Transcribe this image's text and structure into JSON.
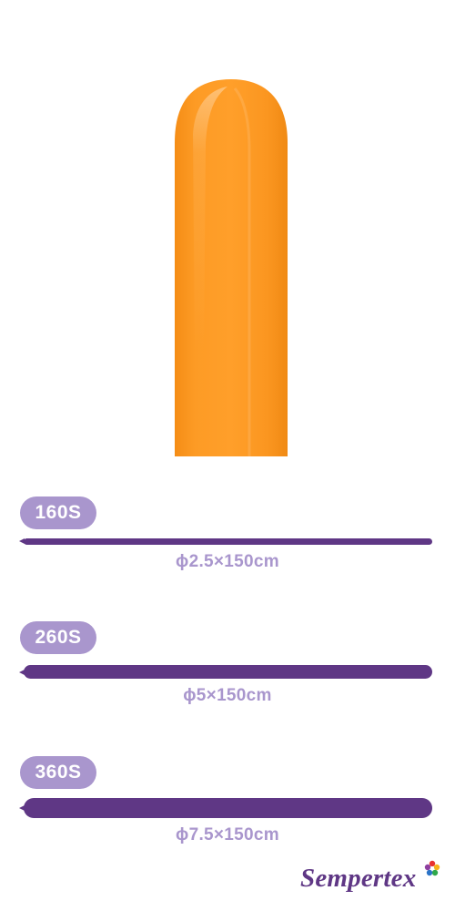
{
  "product": {
    "balloon_color": "#fd9a22"
  },
  "sizes": [
    {
      "code": "160S",
      "dimension": "ϕ2.5×150cm"
    },
    {
      "code": "260S",
      "dimension": "ϕ5×150cm"
    },
    {
      "code": "360S",
      "dimension": "ϕ7.5×150cm"
    }
  ],
  "brand": {
    "name": "Sempertex",
    "accent": "#5f3785",
    "label_color": "#a996cd"
  }
}
